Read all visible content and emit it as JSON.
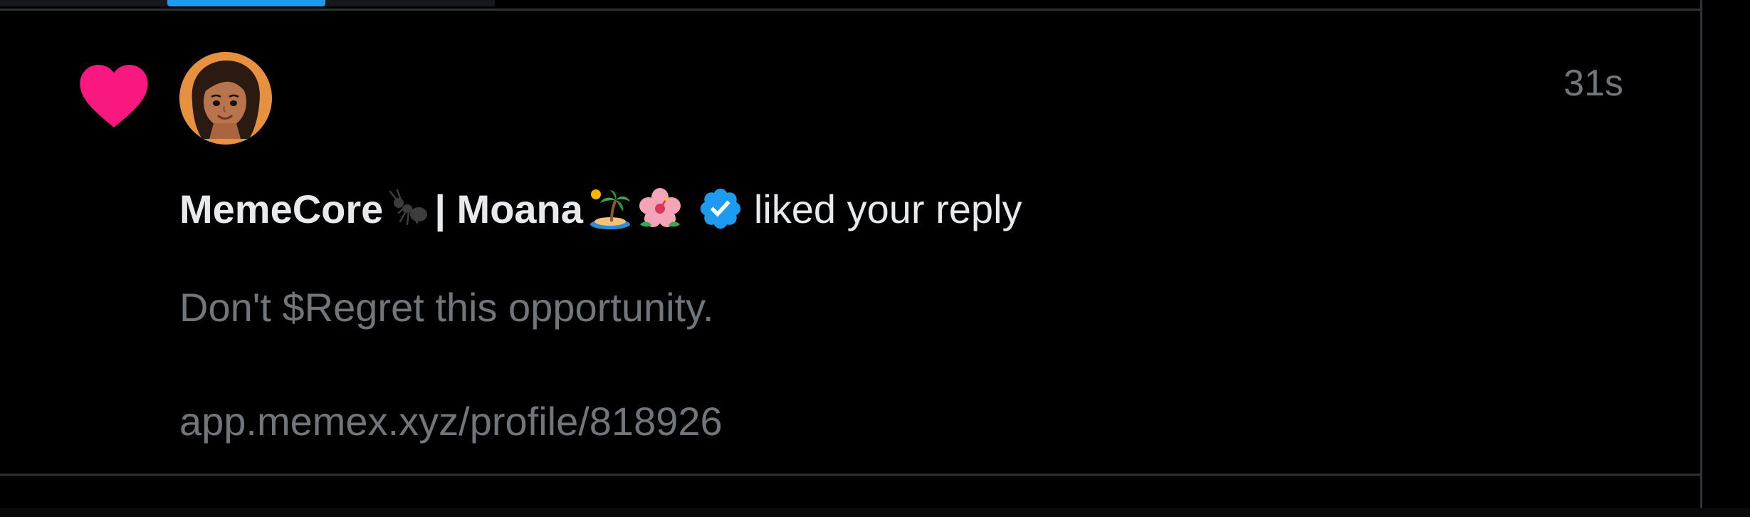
{
  "notification": {
    "timestamp": "31s",
    "actor": {
      "name_part1": "MemeCore",
      "name_part2": " | Moana ",
      "emoji_1": "ant-emoji",
      "emoji_2": "island-emoji",
      "emoji_3": "hibiscus-emoji",
      "verified": true
    },
    "action": "liked your reply",
    "reply": {
      "text": "Don't $Regret this opportunity.",
      "link": "app.memex.xyz/profile/818926"
    },
    "icon": "heart-icon"
  },
  "colors": {
    "background": "#000000",
    "heart": "#f91880",
    "verified": "#1d9bf0",
    "accent": "#1d9bf0",
    "secondary_text": "#71767b",
    "primary_text": "#e7e9ea",
    "divider": "#2f3336"
  }
}
